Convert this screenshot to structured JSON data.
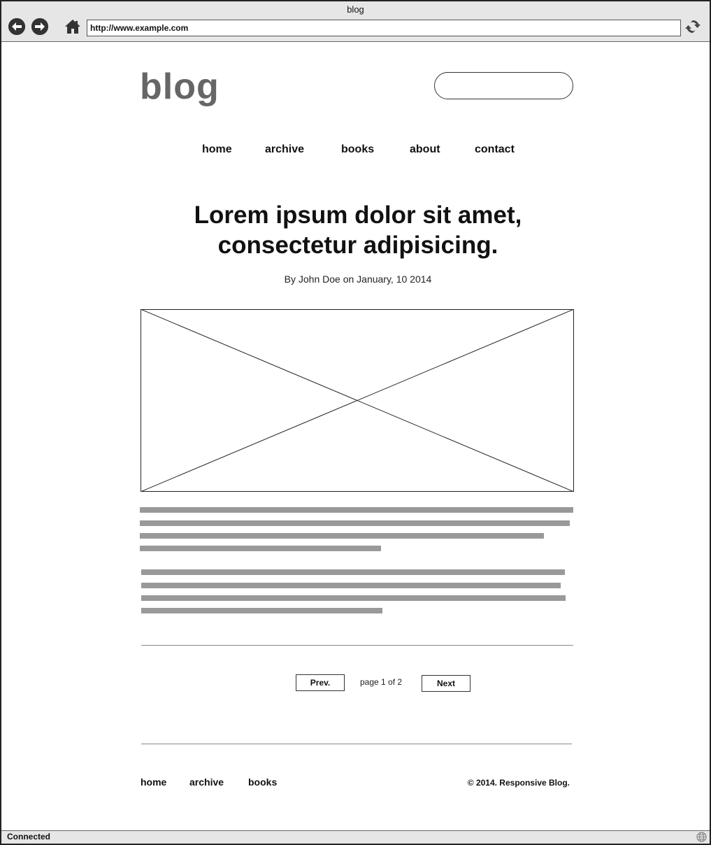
{
  "window": {
    "title": "blog",
    "url": "http://www.example.com",
    "status": "Connected"
  },
  "browser": {
    "back_icon": "arrow-left-circle-icon",
    "forward_icon": "arrow-right-circle-icon",
    "home_icon": "home-icon",
    "refresh_icon": "refresh-icon",
    "status_icon": "globe-icon"
  },
  "header": {
    "logo": "blog",
    "search_value": ""
  },
  "nav": {
    "items": [
      "home",
      "archive",
      "books",
      "about",
      "contact"
    ]
  },
  "article": {
    "title_line1": "Lorem ipsum dolor sit amet,",
    "title_line2": "consectetur adipisicing.",
    "byline": "By John Doe on January, 10 2014"
  },
  "pagination": {
    "prev_label": "Prev.",
    "page_text": "page 1 of 2",
    "next_label": "Next"
  },
  "footer": {
    "links": [
      "home",
      "archive",
      "books"
    ],
    "copyright": "© 2014. Responsive Blog."
  },
  "colors": {
    "chrome": "#e6e6e6",
    "logo": "#666666",
    "placeholder_text": "#999999"
  }
}
